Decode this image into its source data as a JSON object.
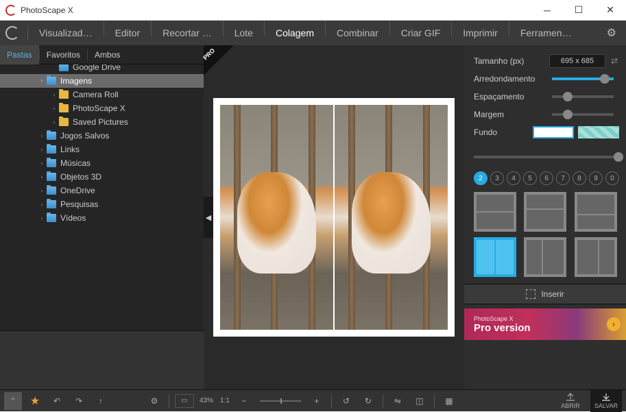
{
  "app": {
    "title": "PhotoScape X"
  },
  "toolbar": {
    "tabs": [
      "Visualizad…",
      "Editor",
      "Recortar …",
      "Lote",
      "Colagem",
      "Combinar",
      "Criar GIF",
      "Imprimir",
      "Ferramen…"
    ],
    "active": 4
  },
  "leftTabs": {
    "items": [
      "Pastas",
      "Favoritos",
      "Ambos"
    ],
    "active": 0
  },
  "tree": [
    {
      "indent": 3,
      "caret": "",
      "label": "Google Drive",
      "blue": true,
      "cut": true
    },
    {
      "indent": 2,
      "caret": "▾",
      "label": "Imagens",
      "blue": true,
      "selected": true
    },
    {
      "indent": 3,
      "caret": "›",
      "label": "Camera Roll"
    },
    {
      "indent": 3,
      "caret": "›",
      "label": "PhotoScape X"
    },
    {
      "indent": 3,
      "caret": "›",
      "label": "Saved Pictures"
    },
    {
      "indent": 2,
      "caret": "›",
      "label": "Jogos Salvos",
      "blue": true
    },
    {
      "indent": 2,
      "caret": "›",
      "label": "Links",
      "blue": true
    },
    {
      "indent": 2,
      "caret": "›",
      "label": "Músicas",
      "blue": true
    },
    {
      "indent": 2,
      "caret": "›",
      "label": "Objetos 3D",
      "blue": true
    },
    {
      "indent": 2,
      "caret": "›",
      "label": "OneDrive",
      "blue": true
    },
    {
      "indent": 2,
      "caret": "›",
      "label": "Pesquisas",
      "blue": true
    },
    {
      "indent": 2,
      "caret": "›",
      "label": "Vídeos",
      "blue": true
    }
  ],
  "proBadge": "PRO",
  "props": {
    "sizeLabel": "Tamanho (px)",
    "sizeValue": "695 x 685",
    "roundLabel": "Arredondamento",
    "spacingLabel": "Espaçamento",
    "marginLabel": "Margem",
    "bgLabel": "Fundo"
  },
  "numRow": {
    "items": [
      "2",
      "3",
      "4",
      "5",
      "6",
      "7",
      "8",
      "9",
      "0"
    ],
    "active": 0
  },
  "insertLabel": "Inserir",
  "banner": {
    "line1": "PhotoScape X",
    "line2": "Pro version"
  },
  "bottom": {
    "zoomPct": "43%",
    "zoomRatio": "1:1",
    "openLabel": "ABRIR",
    "saveLabel": "SALVAR"
  }
}
